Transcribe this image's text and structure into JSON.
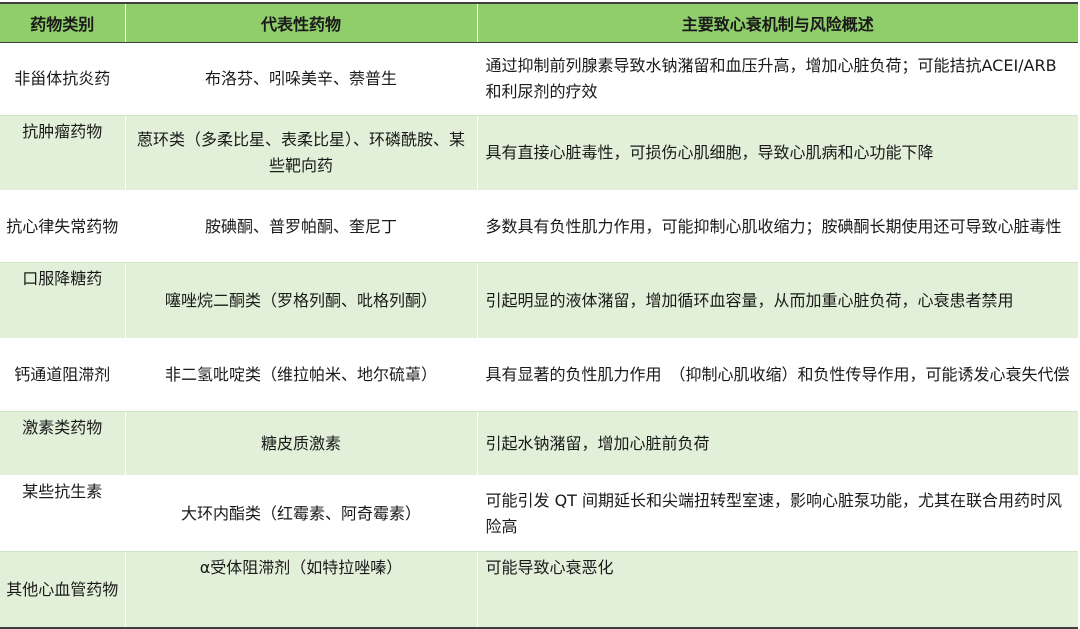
{
  "table": {
    "headers": [
      "药物类别",
      "代表性药物",
      "主要致心衰机制与风险概述"
    ],
    "rows": [
      {
        "category": "非甾体抗炎药",
        "drugs": "布洛芬、吲哚美辛、萘普生",
        "mechanism": "通过抑制前列腺素导致水钠潴留和血压升高，增加心脏负荷；可能拮抗ACEI/ARB 和利尿剂的疗效"
      },
      {
        "category": "抗肿瘤药物",
        "drugs": "蒽环类（多柔比星、表柔比星）、环磷酰胺、某些靶向药",
        "mechanism": "具有直接心脏毒性，可损伤心肌细胞，导致心肌病和心功能下降"
      },
      {
        "category": "抗心律失常药物",
        "drugs": "胺碘酮、普罗帕酮、奎尼丁",
        "mechanism": "多数具有负性肌力作用，可能抑制心肌收缩力；胺碘酮长期使用还可导致心脏毒性"
      },
      {
        "category": "口服降糖药",
        "drugs": "噻唑烷二酮类（罗格列酮、吡格列酮）",
        "mechanism": "引起明显的液体潴留，增加循环血容量，从而加重心脏负荷，心衰患者禁用"
      },
      {
        "category": "钙通道阻滞剂",
        "drugs": "非二氢吡啶类（维拉帕米、地尔硫䓬）",
        "mechanism": "具有显著的负性肌力作用　（抑制心肌收缩）和负性传导作用，可能诱发心衰失代偿"
      },
      {
        "category": "激素类药物",
        "drugs": "糖皮质激素",
        "mechanism": "引起水钠潴留，增加心脏前负荷"
      },
      {
        "category": "某些抗生素",
        "drugs": "大环内酯类（红霉素、阿奇霉素）",
        "mechanism": "可能引发 QT 间期延长和尖端扭转型室速，影响心脏泵功能，尤其在联合用药时风险高"
      },
      {
        "category": "其他心血管药物",
        "drugs": "α受体阻滞剂（如特拉唑嗪）",
        "mechanism": "可能导致心衰恶化"
      }
    ]
  }
}
